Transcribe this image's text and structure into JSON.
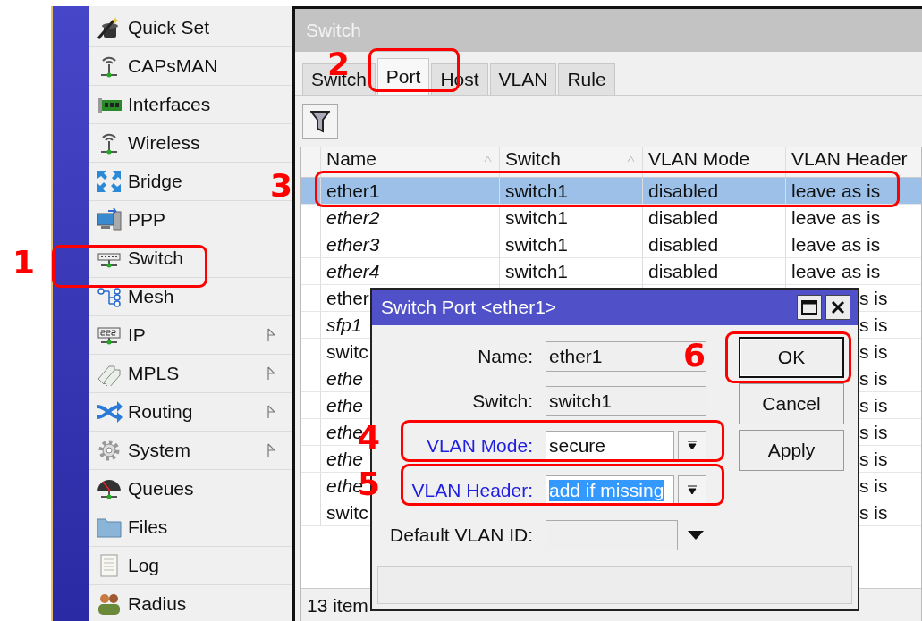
{
  "sidebar": {
    "items": [
      {
        "label": "Quick Set",
        "has_submenu": false
      },
      {
        "label": "CAPsMAN",
        "has_submenu": false
      },
      {
        "label": "Interfaces",
        "has_submenu": false
      },
      {
        "label": "Wireless",
        "has_submenu": false
      },
      {
        "label": "Bridge",
        "has_submenu": false
      },
      {
        "label": "PPP",
        "has_submenu": false
      },
      {
        "label": "Switch",
        "has_submenu": false
      },
      {
        "label": "Mesh",
        "has_submenu": false
      },
      {
        "label": "IP",
        "has_submenu": true
      },
      {
        "label": "MPLS",
        "has_submenu": true
      },
      {
        "label": "Routing",
        "has_submenu": true
      },
      {
        "label": "System",
        "has_submenu": true
      },
      {
        "label": "Queues",
        "has_submenu": false
      },
      {
        "label": "Files",
        "has_submenu": false
      },
      {
        "label": "Log",
        "has_submenu": false
      },
      {
        "label": "Radius",
        "has_submenu": false
      }
    ]
  },
  "switch_window": {
    "title": "Switch",
    "tabs": [
      {
        "label": "Switch",
        "selected": false
      },
      {
        "label": "Port",
        "selected": true
      },
      {
        "label": "Host",
        "selected": false
      },
      {
        "label": "VLAN",
        "selected": false
      },
      {
        "label": "Rule",
        "selected": false
      }
    ],
    "table": {
      "columns": [
        "Name",
        "Switch",
        "VLAN Mode",
        "VLAN Header"
      ],
      "rows": [
        {
          "selected": true,
          "running": true,
          "cells": [
            "ether1",
            "switch1",
            "disabled",
            "leave as is"
          ]
        },
        {
          "selected": false,
          "running": false,
          "cells": [
            "ether2",
            "switch1",
            "disabled",
            "leave as is"
          ]
        },
        {
          "selected": false,
          "running": false,
          "cells": [
            "ether3",
            "switch1",
            "disabled",
            "leave as is"
          ]
        },
        {
          "selected": false,
          "running": false,
          "cells": [
            "ether4",
            "switch1",
            "disabled",
            "leave as is"
          ]
        },
        {
          "selected": false,
          "running": true,
          "cells": [
            "ether",
            null,
            null,
            "s is"
          ]
        },
        {
          "selected": false,
          "running": false,
          "cells": [
            "sfp1",
            null,
            null,
            "s is"
          ]
        },
        {
          "selected": false,
          "running": true,
          "cells": [
            "switc",
            null,
            null,
            "s is"
          ]
        },
        {
          "selected": false,
          "running": false,
          "cells": [
            "ethe",
            null,
            null,
            "s is"
          ]
        },
        {
          "selected": false,
          "running": false,
          "cells": [
            "ethe",
            null,
            null,
            "s is"
          ]
        },
        {
          "selected": false,
          "running": false,
          "cells": [
            "ethe",
            null,
            null,
            "s is"
          ]
        },
        {
          "selected": false,
          "running": false,
          "cells": [
            "ethe",
            null,
            null,
            "s is"
          ]
        },
        {
          "selected": false,
          "running": false,
          "cells": [
            "ethe",
            null,
            null,
            "s is"
          ]
        },
        {
          "selected": false,
          "running": true,
          "cells": [
            "switc",
            null,
            null,
            "s is"
          ]
        }
      ]
    },
    "status": "13 item"
  },
  "dialog": {
    "title": "Switch Port <ether1>",
    "fields": [
      {
        "kind": "readonly",
        "label": "Name:",
        "value": "ether1",
        "modified": false,
        "text_selected": false
      },
      {
        "kind": "readonly",
        "label": "Switch:",
        "value": "switch1",
        "modified": false,
        "text_selected": false
      },
      {
        "kind": "dropdown",
        "label": "VLAN Mode:",
        "value": "secure",
        "modified": true,
        "text_selected": false
      },
      {
        "kind": "dropdown",
        "label": "VLAN Header:",
        "value": "add if missing",
        "modified": true,
        "text_selected": true
      },
      {
        "kind": "combo",
        "label": "Default VLAN ID:",
        "modified": false,
        "text_selected": false
      }
    ],
    "buttons": [
      {
        "label": "OK",
        "focused": true
      },
      {
        "label": "Cancel",
        "focused": false
      },
      {
        "label": "Apply",
        "focused": false
      }
    ]
  },
  "annotations": [
    {
      "label": "1"
    },
    {
      "label": "2"
    },
    {
      "label": "3"
    },
    {
      "label": "4"
    },
    {
      "label": "5"
    },
    {
      "label": "6"
    }
  ]
}
